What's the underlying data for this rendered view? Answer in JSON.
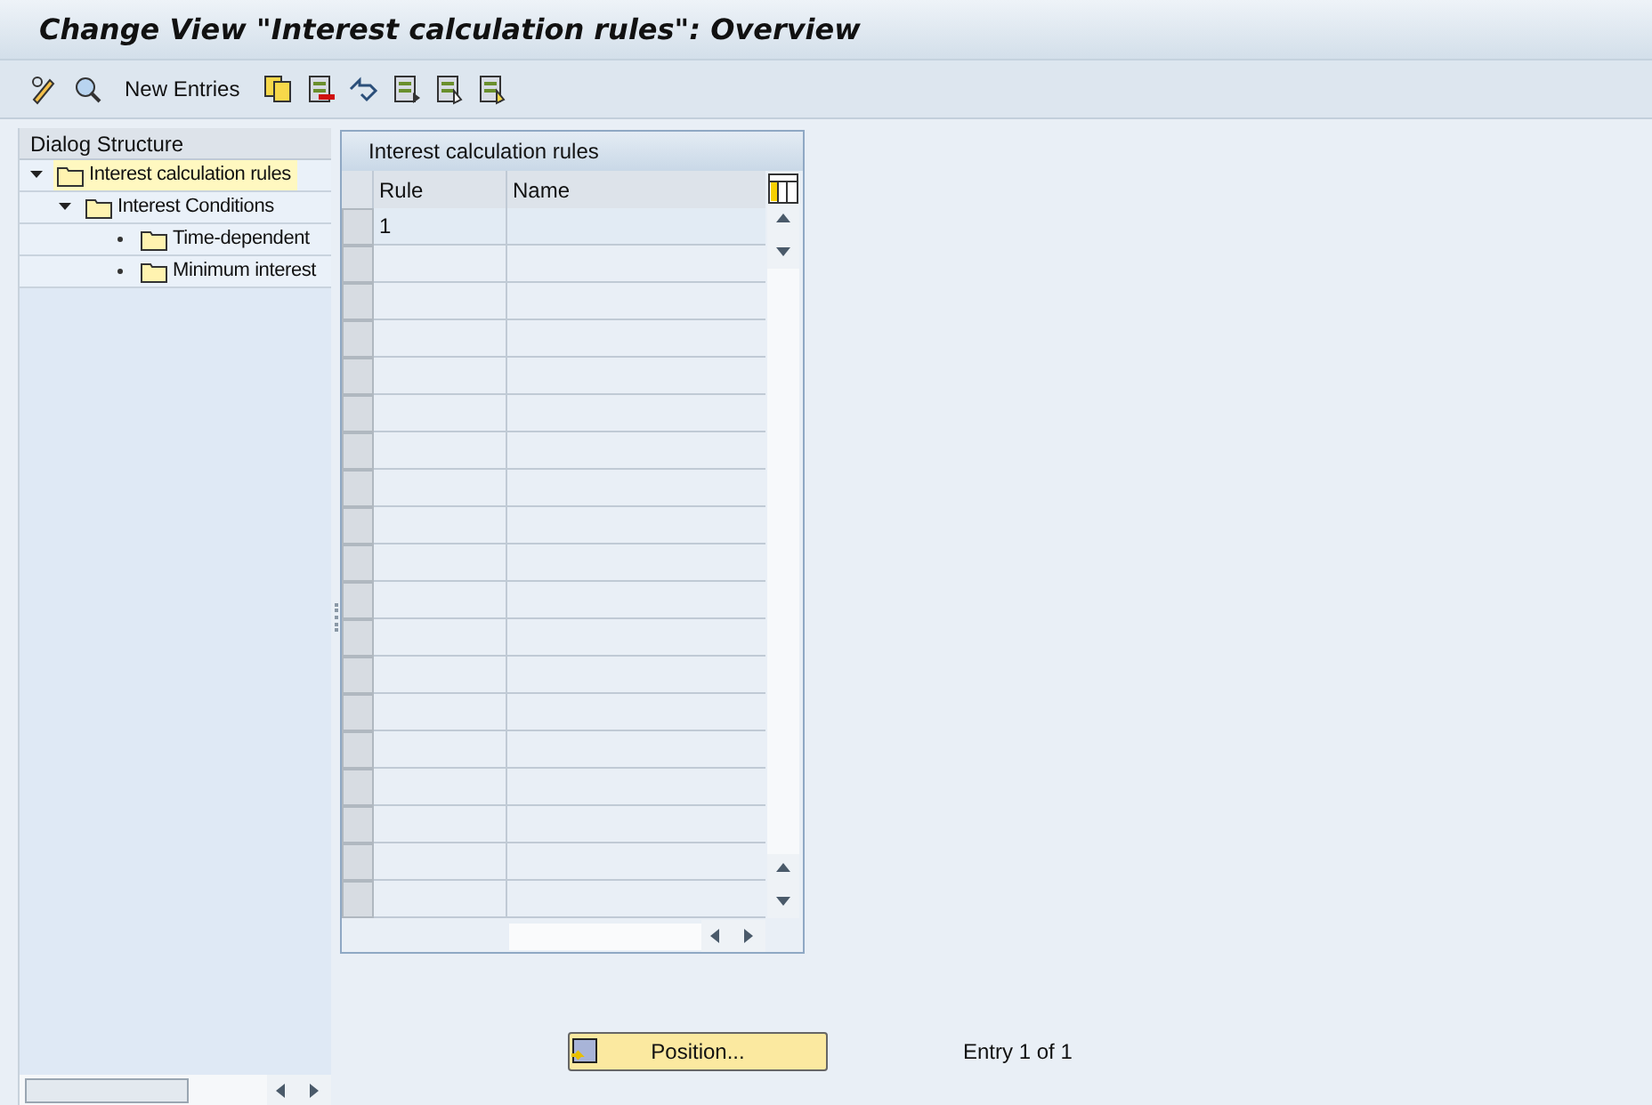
{
  "window": {
    "title": "Change View \"Interest calculation rules\": Overview"
  },
  "toolbar": {
    "new_entries": "New Entries"
  },
  "dialog_structure": {
    "title": "Dialog Structure",
    "items": [
      {
        "label": "Interest calculation rules",
        "selected": true,
        "expanded": true,
        "children": [
          {
            "label": "Interest Conditions",
            "selected": false,
            "expanded": true,
            "children": [
              {
                "label": "Time-dependent",
                "selected": false
              },
              {
                "label": "Minimum interest",
                "selected": false
              }
            ]
          }
        ]
      }
    ]
  },
  "table": {
    "title": "Interest calculation rules",
    "columns": [
      "Rule",
      "Name"
    ],
    "rows": [
      {
        "rule": "1"
      }
    ]
  },
  "footer": {
    "position_button": "Position...",
    "entry_info": "Entry 1 of 1"
  }
}
